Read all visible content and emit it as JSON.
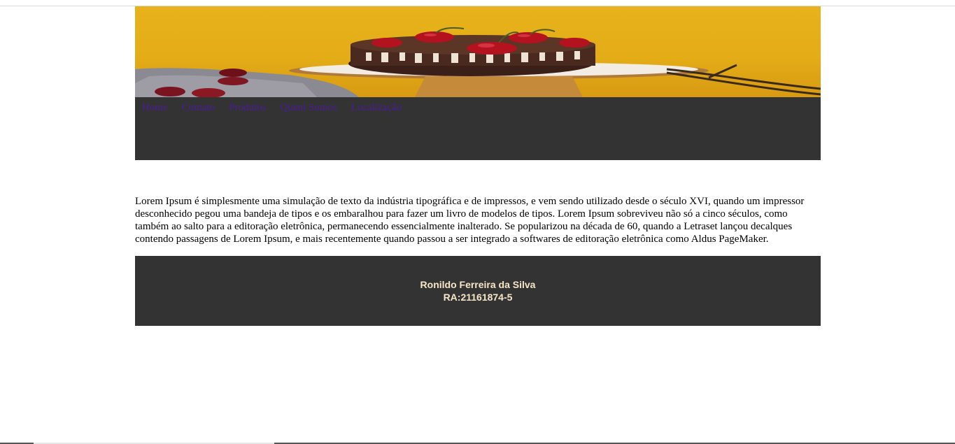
{
  "banner": {
    "alt": "cake-banner"
  },
  "nav": {
    "items": [
      {
        "label": "Home"
      },
      {
        "label": "Contato"
      },
      {
        "label": "Produtos"
      },
      {
        "label": "Quem Somos"
      },
      {
        "label": "Localização"
      }
    ]
  },
  "content": {
    "paragraph": "Lorem Ipsum é simplesmente uma simulação de texto da indústria tipográfica e de impressos, e vem sendo utilizado desde o século XVI, quando um impressor desconhecido pegou uma bandeja de tipos e os embaralhou para fazer um livro de modelos de tipos. Lorem Ipsum sobreviveu não só a cinco séculos, como também ao salto para a editoração eletrônica, permanecendo essencialmente inalterado. Se popularizou na década de 60, quando a Letraset lançou decalques contendo passagens de Lorem Ipsum, e mais recentemente quando passou a ser integrado a softwares de editoração eletrônica como Aldus PageMaker."
  },
  "footer": {
    "name": "Ronildo Ferreira da Silva",
    "ra": "RA:21161874-5"
  },
  "colors": {
    "nav_background": "#333333",
    "nav_link": "#4d1a9a",
    "footer_text": "#f7e6c7",
    "banner_yellow": "#e5ad17"
  }
}
